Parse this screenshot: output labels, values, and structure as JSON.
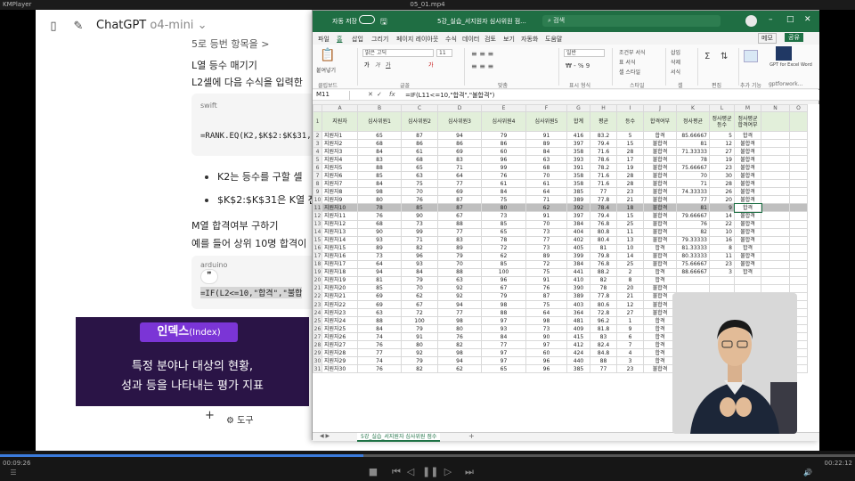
{
  "player": {
    "app_name": "KMPlayer",
    "file_name": "05_01.mp4",
    "time_elapsed": "00:09:26",
    "time_total": "00:22:12",
    "progress_fraction": 0.425
  },
  "chatgpt": {
    "title": "ChatGPT",
    "model": "o4-mini",
    "line_top": "5로 등번 항목을 >",
    "heading_rank": "L열 등수 매기기",
    "instruction": "L2셀에 다음 수식을 입력한",
    "code_lang_1": "swift",
    "code_1": "=RANK.EQ(K2,$K$2:$K$31,",
    "bullet_1": "K2는 등수를 구할 셀",
    "bullet_2": "$K$2:$K$31은 K열 전처",
    "heading_pass": "M열 합격여부 구하기",
    "example": "예를 들어 상위 10명 합격이",
    "code_lang_2": "arduino",
    "code_2": "=IF(L2<=10,\"합격\",\"불합",
    "quote_glyph": "❞",
    "tools_label": "도구"
  },
  "caption": {
    "tag": "인덱스",
    "tag_sub": "(Index)",
    "line1": "특정 분야나 대상의 현황,",
    "line2": "성과 등을 나타내는 평가 지표"
  },
  "excel": {
    "autosave": "자동 저장",
    "file_title": "5강_실습_서지원자 심사위원 점...",
    "search_placeholder": "검색",
    "tabs": [
      "파일",
      "홈",
      "삽입",
      "그리기",
      "페이지 레이아웃",
      "수식",
      "데이터",
      "검토",
      "보기",
      "자동화",
      "도움말"
    ],
    "comment_btn": "메모",
    "share_btn": "공유",
    "ribbon": {
      "paste": "붙여넣기",
      "clipboard": "클립보드",
      "font_name": "맑은 고딕",
      "font_size": "11",
      "font_group": "글꼴",
      "align_group": "맞춤",
      "number_format": "일반",
      "number_group": "표시 형식",
      "cond_format": "조건부 서식",
      "table_format": "표 서식",
      "cell_style": "셀 스타일",
      "style_group": "스타일",
      "insert": "삽입",
      "delete": "삭제",
      "format": "서식",
      "cells_group": "셀",
      "edit_group": "편집",
      "addins": "추가 기능",
      "gpt_addin": "GPT for Excel Word",
      "gpt_sub": "gptforwork..."
    },
    "name_box": "M11",
    "formula": "=IF(L11<=10,\"합격\",\"불합격\")",
    "col_letters": [
      "",
      "A",
      "B",
      "C",
      "D",
      "E",
      "F",
      "G",
      "H",
      "I",
      "J",
      "K",
      "L",
      "M",
      "N",
      "O"
    ],
    "headers": [
      "지원자",
      "심사위원1",
      "심사위원2",
      "심사위원3",
      "심사위원4",
      "심사위원5",
      "합계",
      "평균",
      "등수",
      "합격여부",
      "정사평균",
      "정사평균 등수",
      "정사평균 합격여부"
    ],
    "rows": [
      [
        "지원자1",
        "65",
        "87",
        "94",
        "79",
        "91",
        "416",
        "83.2",
        "5",
        "합격",
        "85.66667",
        "5",
        "합격"
      ],
      [
        "지원자2",
        "68",
        "86",
        "86",
        "86",
        "89",
        "397",
        "79.4",
        "15",
        "불합격",
        "81",
        "12",
        "불합격"
      ],
      [
        "지원자3",
        "84",
        "61",
        "69",
        "60",
        "84",
        "358",
        "71.6",
        "28",
        "불합격",
        "71.33333",
        "27",
        "불합격"
      ],
      [
        "지원자4",
        "83",
        "68",
        "83",
        "96",
        "63",
        "393",
        "78.6",
        "17",
        "불합격",
        "78",
        "19",
        "불합격"
      ],
      [
        "지원자5",
        "88",
        "65",
        "71",
        "99",
        "68",
        "391",
        "78.2",
        "19",
        "불합격",
        "75.66667",
        "23",
        "불합격"
      ],
      [
        "지원자6",
        "85",
        "63",
        "64",
        "76",
        "70",
        "358",
        "71.6",
        "28",
        "불합격",
        "70",
        "30",
        "불합격"
      ],
      [
        "지원자7",
        "84",
        "75",
        "77",
        "61",
        "61",
        "358",
        "71.6",
        "28",
        "불합격",
        "71",
        "28",
        "불합격"
      ],
      [
        "지원자8",
        "98",
        "70",
        "69",
        "84",
        "64",
        "385",
        "77",
        "23",
        "불합격",
        "74.33333",
        "26",
        "불합격"
      ],
      [
        "지원자9",
        "80",
        "76",
        "87",
        "75",
        "71",
        "389",
        "77.8",
        "21",
        "불합격",
        "77",
        "20",
        "불합격"
      ],
      [
        "지원자10",
        "78",
        "85",
        "87",
        "80",
        "62",
        "392",
        "78.4",
        "18",
        "불합격",
        "81",
        "9",
        "합격"
      ],
      [
        "지원자11",
        "76",
        "90",
        "67",
        "73",
        "91",
        "397",
        "79.4",
        "15",
        "불합격",
        "79.66667",
        "14",
        "불합격"
      ],
      [
        "지원자12",
        "68",
        "73",
        "88",
        "85",
        "70",
        "384",
        "76.8",
        "25",
        "불합격",
        "76",
        "22",
        "불합격"
      ],
      [
        "지원자13",
        "90",
        "99",
        "77",
        "65",
        "73",
        "404",
        "80.8",
        "11",
        "불합격",
        "82",
        "10",
        "불합격"
      ],
      [
        "지원자14",
        "93",
        "71",
        "83",
        "78",
        "77",
        "402",
        "80.4",
        "13",
        "불합격",
        "79.33333",
        "16",
        "불합격"
      ],
      [
        "지원자15",
        "89",
        "82",
        "89",
        "72",
        "73",
        "405",
        "81",
        "10",
        "합격",
        "81.33333",
        "8",
        "합격"
      ],
      [
        "지원자16",
        "73",
        "96",
        "79",
        "62",
        "89",
        "399",
        "79.8",
        "14",
        "불합격",
        "80.33333",
        "11",
        "불합격"
      ],
      [
        "지원자17",
        "64",
        "93",
        "70",
        "85",
        "72",
        "384",
        "76.8",
        "25",
        "불합격",
        "75.66667",
        "23",
        "불합격"
      ],
      [
        "지원자18",
        "94",
        "84",
        "88",
        "100",
        "75",
        "441",
        "88.2",
        "2",
        "합격",
        "88.66667",
        "3",
        "합격"
      ],
      [
        "지원자19",
        "81",
        "79",
        "63",
        "96",
        "91",
        "410",
        "82",
        "8",
        "합격",
        "",
        "",
        ""
      ],
      [
        "지원자20",
        "85",
        "70",
        "92",
        "67",
        "76",
        "390",
        "78",
        "20",
        "불합격",
        "",
        "",
        ""
      ],
      [
        "지원자21",
        "69",
        "62",
        "92",
        "79",
        "87",
        "389",
        "77.8",
        "21",
        "불합격",
        "",
        "",
        ""
      ],
      [
        "지원자22",
        "69",
        "67",
        "94",
        "98",
        "75",
        "403",
        "80.6",
        "12",
        "불합격",
        "",
        "",
        ""
      ],
      [
        "지원자23",
        "63",
        "72",
        "77",
        "88",
        "64",
        "364",
        "72.8",
        "27",
        "불합격",
        "",
        "",
        ""
      ],
      [
        "지원자24",
        "88",
        "100",
        "98",
        "97",
        "98",
        "481",
        "96.2",
        "1",
        "합격",
        "",
        "",
        ""
      ],
      [
        "지원자25",
        "84",
        "79",
        "80",
        "93",
        "73",
        "409",
        "81.8",
        "9",
        "합격",
        "",
        "",
        ""
      ],
      [
        "지원자26",
        "74",
        "91",
        "76",
        "84",
        "90",
        "415",
        "83",
        "6",
        "합격",
        "",
        "",
        ""
      ],
      [
        "지원자27",
        "76",
        "80",
        "82",
        "77",
        "97",
        "412",
        "82.4",
        "7",
        "합격",
        "",
        "",
        ""
      ],
      [
        "지원자28",
        "77",
        "92",
        "98",
        "97",
        "60",
        "424",
        "84.8",
        "4",
        "합격",
        "",
        "",
        ""
      ],
      [
        "지원자29",
        "74",
        "79",
        "94",
        "97",
        "96",
        "440",
        "88",
        "3",
        "합격",
        "",
        "",
        ""
      ],
      [
        "지원자30",
        "76",
        "82",
        "62",
        "65",
        "96",
        "385",
        "77",
        "23",
        "불합격",
        "",
        "",
        ""
      ]
    ],
    "sheet_tab": "5강_실습_서지원자 심사위원 점수",
    "colors": {
      "excel_green": "#1e7145",
      "header_fill": "#e2efda",
      "caption_bg": "#2a1446",
      "caption_tag": "#7b35d6"
    }
  }
}
